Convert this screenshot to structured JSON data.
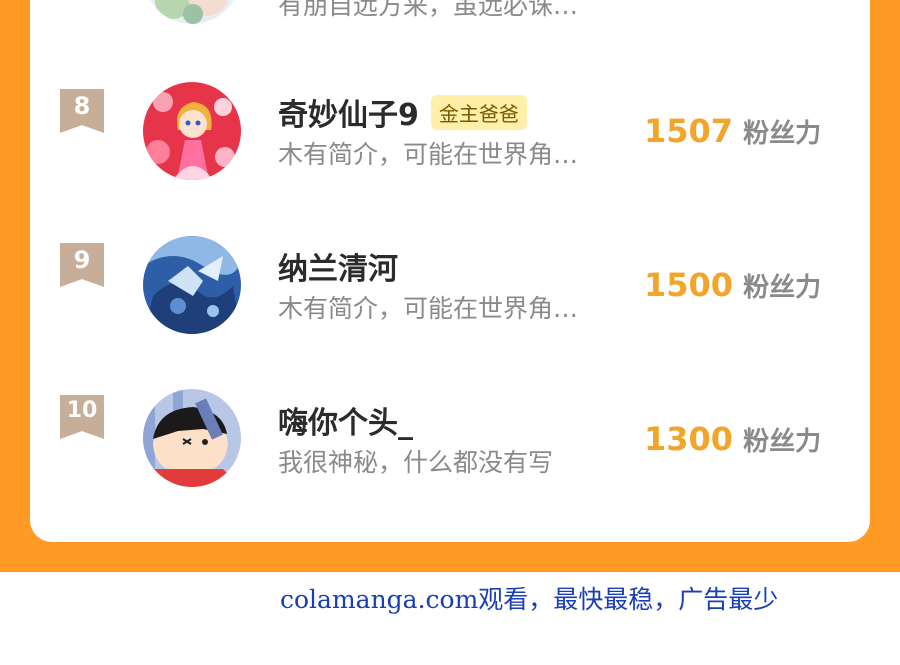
{
  "top_partial": {
    "desc": "有朋自远方来，虽远必诛…"
  },
  "entries": [
    {
      "rank": "8",
      "name": "奇妙仙子9",
      "badge": "金主爸爸",
      "desc": "木有简介，可能在世界角…",
      "score": "1507",
      "unit": "粉丝力",
      "avatar_icon": "fairy-avatar-icon"
    },
    {
      "rank": "9",
      "name": "纳兰清河",
      "badge": "",
      "desc": "木有简介，可能在世界角…",
      "score": "1500",
      "unit": "粉丝力",
      "avatar_icon": "blue-dragon-avatar-icon"
    },
    {
      "rank": "10",
      "name": "嗨你个头_",
      "badge": "",
      "desc": "我很神秘，什么都没有写",
      "score": "1300",
      "unit": "粉丝力",
      "avatar_icon": "cartoon-boy-avatar-icon"
    }
  ],
  "footer": {
    "text": "colamanga.com观看，最快最稳，广告最少"
  },
  "colors": {
    "orange": "#FF9B25",
    "score": "#F2A52B",
    "rank_ribbon": "#C7AE98",
    "badge_bg": "#FFEFA8",
    "footer_text": "#1a3db8"
  }
}
